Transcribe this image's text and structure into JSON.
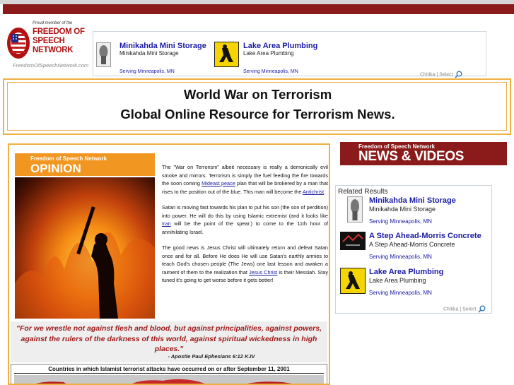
{
  "logo": {
    "tagline": "Proud member of the",
    "title": "FREEDOM OF SPEECH NETWORK",
    "url": "FreedomOfSpeechNetwork.com"
  },
  "top_ads": [
    {
      "title": "Minikahda Mini Storage",
      "subtitle": "Minikahda Mini Storage",
      "serving": "Serving Minneapolis, MN",
      "icon": "storage-icon"
    },
    {
      "title": "Lake Area Plumbing",
      "subtitle": "Lake Area Plumbing",
      "serving": "Serving Minneapolis, MN",
      "icon": "yellow-pages-icon"
    }
  ],
  "chitika_label": "Chitika | Select",
  "banner": {
    "line1": "World War on Terrorism",
    "line2": "Global Online Resource for Terrorism News."
  },
  "opinion": {
    "network_label": "Freedom of Speech Network",
    "section_label": "OPINION"
  },
  "article": {
    "p1_a": "The \"War on Terrorism\" albeit necessary is really a demonically evil smoke and mirrors. Terrorism is simply the fuel feeding the fire towards the soon coming ",
    "p1_link1": "Mideast peace",
    "p1_b": " plan that will be brokered by a man that rises to the position out of the blue. This man will become the ",
    "p1_link2": "Antichrist",
    "p1_c": ".",
    "p2_a": "Satan is moving fast towards his plan to put his son (the son of perdition) into power. He will do this by using Islamic extremist (and it looks like ",
    "p2_link": "Iran",
    "p2_b": " will be the point of the spear.) to come to the 11th hour of annihilating Israel.",
    "p3_a": "The good news is Jesus Christ will ultimately return and defeat Satan once and for all. Before He does He will use Satan's earthly armies to teach God's chosen people (The Jews) one last lesson and awaken a raiment of them to the realization that ",
    "p3_link": "Jesus Christ",
    "p3_b": " is their Messiah. Stay tuned it's going to get worse before it gets better!"
  },
  "quote": {
    "text": "\"For we wrestle not against flesh and blood, but against principalities, against powers, against the rulers of the darkness of this world, against spiritual wickedness in high places.\"",
    "citation": "- Apostle Paul  Ephesians  6:12 KJV"
  },
  "map": {
    "title": "Countries in which Islamist terrorist attacks have occurred on or after September 11, 2001"
  },
  "news": {
    "network_label": "Freedom of Speech Network",
    "label": "NEWS & VIDEOS"
  },
  "related": {
    "heading": "Related Results",
    "items": [
      {
        "title": "Minikahda Mini Storage",
        "subtitle": "Minikahda Mini Storage",
        "serving": "Serving Minneapolis, MN",
        "icon": "storage-icon"
      },
      {
        "title": "A Step Ahead-Morris Concrete",
        "subtitle": "A Step Ahead-Morris Concrete",
        "serving": "Serving Minneapolis, MN",
        "icon": "concrete-logo-icon"
      },
      {
        "title": "Lake Area Plumbing",
        "subtitle": "Lake Area Plumbing",
        "serving": "Serving Minneapolis, MN",
        "icon": "yellow-pages-icon"
      }
    ]
  },
  "colors": {
    "top_bar": "#8b1a1a",
    "accent_orange": "#f29622",
    "banner_border": "#f0b040",
    "link_blue": "#1a1aa6",
    "quote_red": "#a01a1a"
  }
}
